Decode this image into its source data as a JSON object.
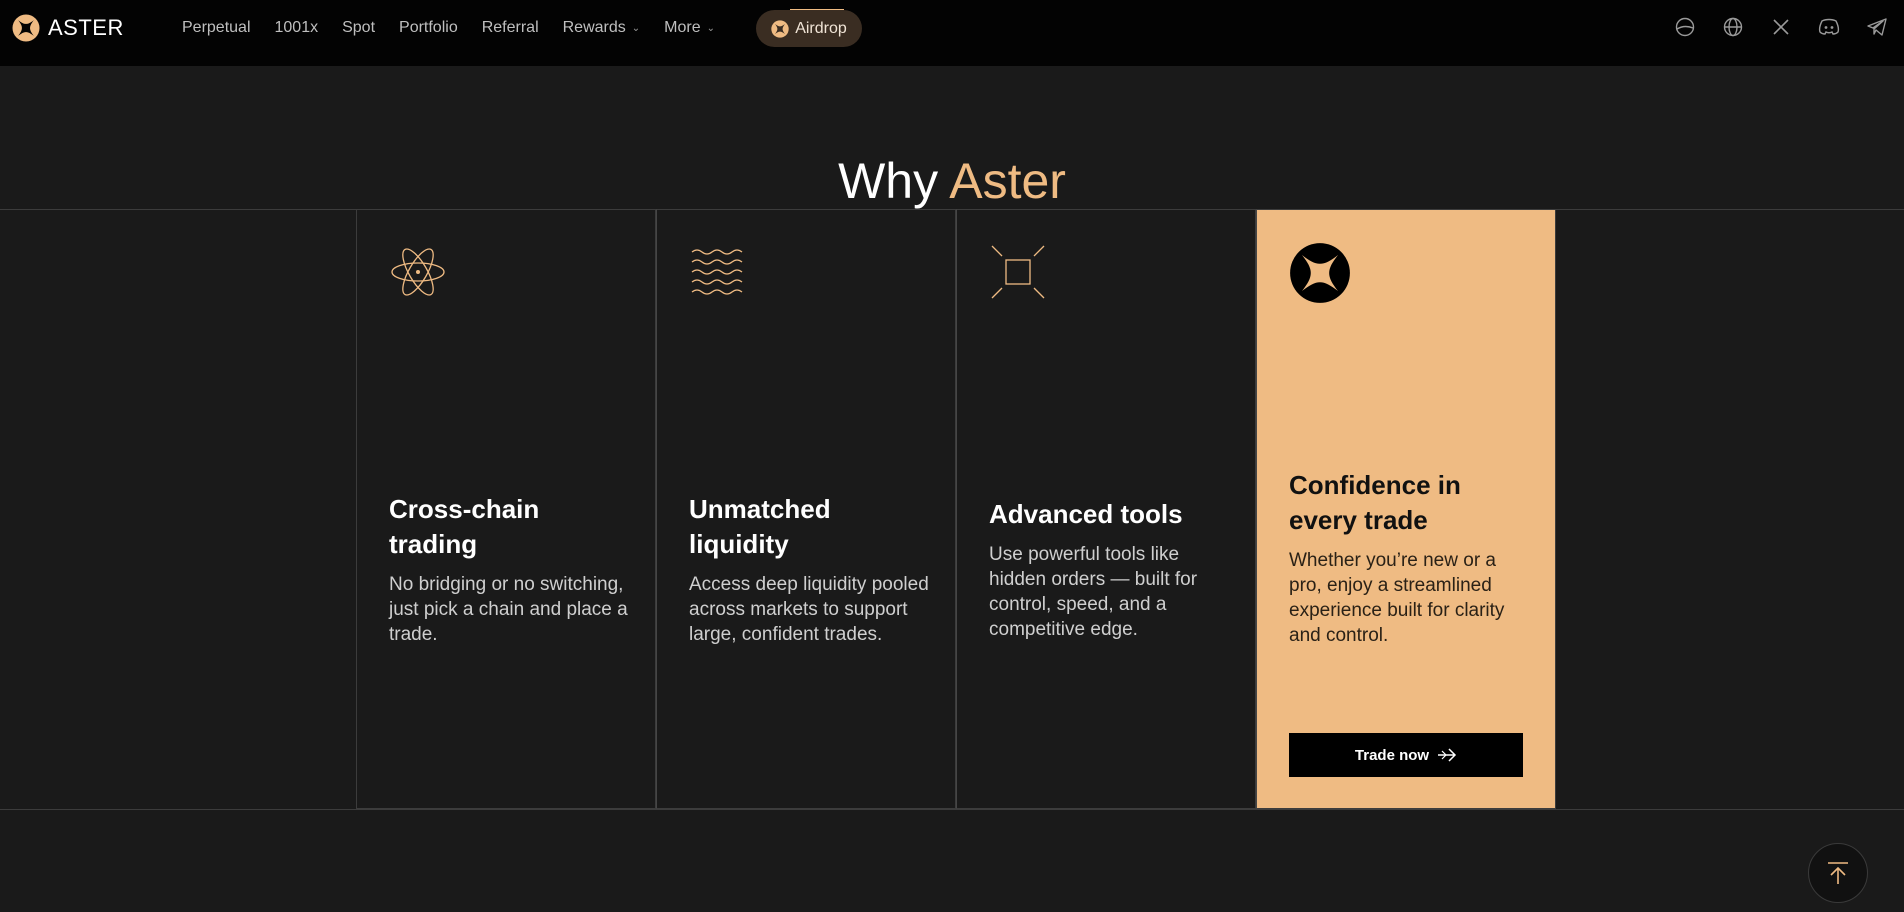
{
  "brand": {
    "name": "ASTER",
    "logo_icon": "aster-star-icon"
  },
  "nav": {
    "items": [
      {
        "label": "Perpetual",
        "has_dropdown": false
      },
      {
        "label": "1001x",
        "has_dropdown": false
      },
      {
        "label": "Spot",
        "has_dropdown": false
      },
      {
        "label": "Portfolio",
        "has_dropdown": false
      },
      {
        "label": "Referral",
        "has_dropdown": false
      },
      {
        "label": "Rewards",
        "has_dropdown": true
      },
      {
        "label": "More",
        "has_dropdown": true
      }
    ],
    "airdrop_label": "Airdrop"
  },
  "social_icons": [
    "theme-toggle-icon",
    "globe-icon",
    "x-icon",
    "discord-icon",
    "telegram-icon"
  ],
  "section": {
    "title_prefix": "Why",
    "title_accent": "Aster"
  },
  "cards": [
    {
      "icon": "atom-icon",
      "title": "Cross-chain trading",
      "text": "No bridging or no switching, just pick a chain and place a trade."
    },
    {
      "icon": "waves-icon",
      "title": "Unmatched liquidity",
      "text": "Access deep liquidity pooled across markets to support large, confident trades."
    },
    {
      "icon": "expand-icon",
      "title": "Advanced tools",
      "text": "Use powerful tools like hidden orders — built for control, speed, and a competitive edge."
    },
    {
      "icon": "aster-star-icon",
      "title": "Confidence in every trade",
      "text": "Whether you’re new or a pro, enjoy a streamlined experience built for clarity and control.",
      "button_label": "Trade now"
    }
  ],
  "colors": {
    "accent": "#efbb83",
    "background": "#1a1a1a",
    "topbar": "#030303"
  }
}
